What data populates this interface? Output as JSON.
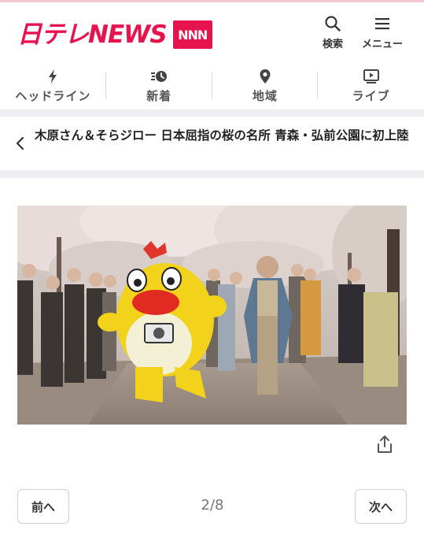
{
  "brand": {
    "logo_text": "日テレNEWS",
    "logo_badge": "NNN",
    "accent_color": "#e6144e"
  },
  "header": {
    "search_label": "検索",
    "menu_label": "メニュー",
    "search_icon": "search-icon",
    "menu_icon": "hamburger-icon"
  },
  "nav": {
    "items": [
      {
        "label": "ヘッドライン",
        "icon": "lightning-icon"
      },
      {
        "label": "新着",
        "icon": "clock-list-icon"
      },
      {
        "label": "地域",
        "icon": "map-pin-icon"
      },
      {
        "label": "ライブ",
        "icon": "play-screen-icon"
      }
    ]
  },
  "article": {
    "title": "木原さん＆そらジロー 日本屈指の桜の名所 青森・弘前公園に初上陸"
  },
  "pager": {
    "prev_label": "前へ",
    "next_label": "次へ",
    "counter": "2/8"
  }
}
